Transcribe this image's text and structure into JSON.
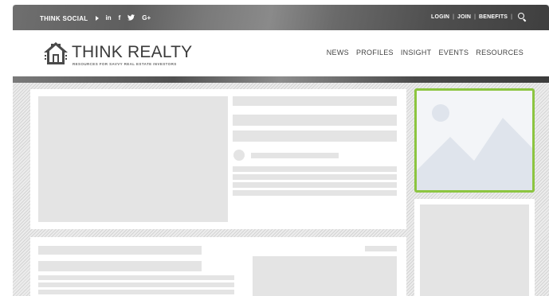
{
  "topbar": {
    "social_label": "THINK SOCIAL",
    "social_icons": [
      {
        "name": "linkedin-icon",
        "glyph": "in"
      },
      {
        "name": "facebook-icon",
        "glyph": "f"
      },
      {
        "name": "twitter-icon",
        "glyph": "♥"
      },
      {
        "name": "google-plus-icon",
        "glyph": "G+"
      }
    ],
    "login": "LOGIN",
    "join": "JOIN",
    "benefits": "BENEFITS",
    "separator": "|"
  },
  "header": {
    "brand": "THINK REALTY",
    "tagline": "RESOURCES FOR SAVVY REAL ESTATE INVESTORS",
    "nav": [
      "NEWS",
      "PROFILES",
      "INSIGHT",
      "EVENTS",
      "RESOURCES"
    ]
  },
  "colors": {
    "accent_green": "#8cc540",
    "placeholder_gray": "#e4e4e4",
    "topbar_dark": "#4f4f4f"
  },
  "icons": {
    "logo": "house-logo-icon",
    "search": "search-icon",
    "image_placeholder": "image-placeholder-icon"
  }
}
